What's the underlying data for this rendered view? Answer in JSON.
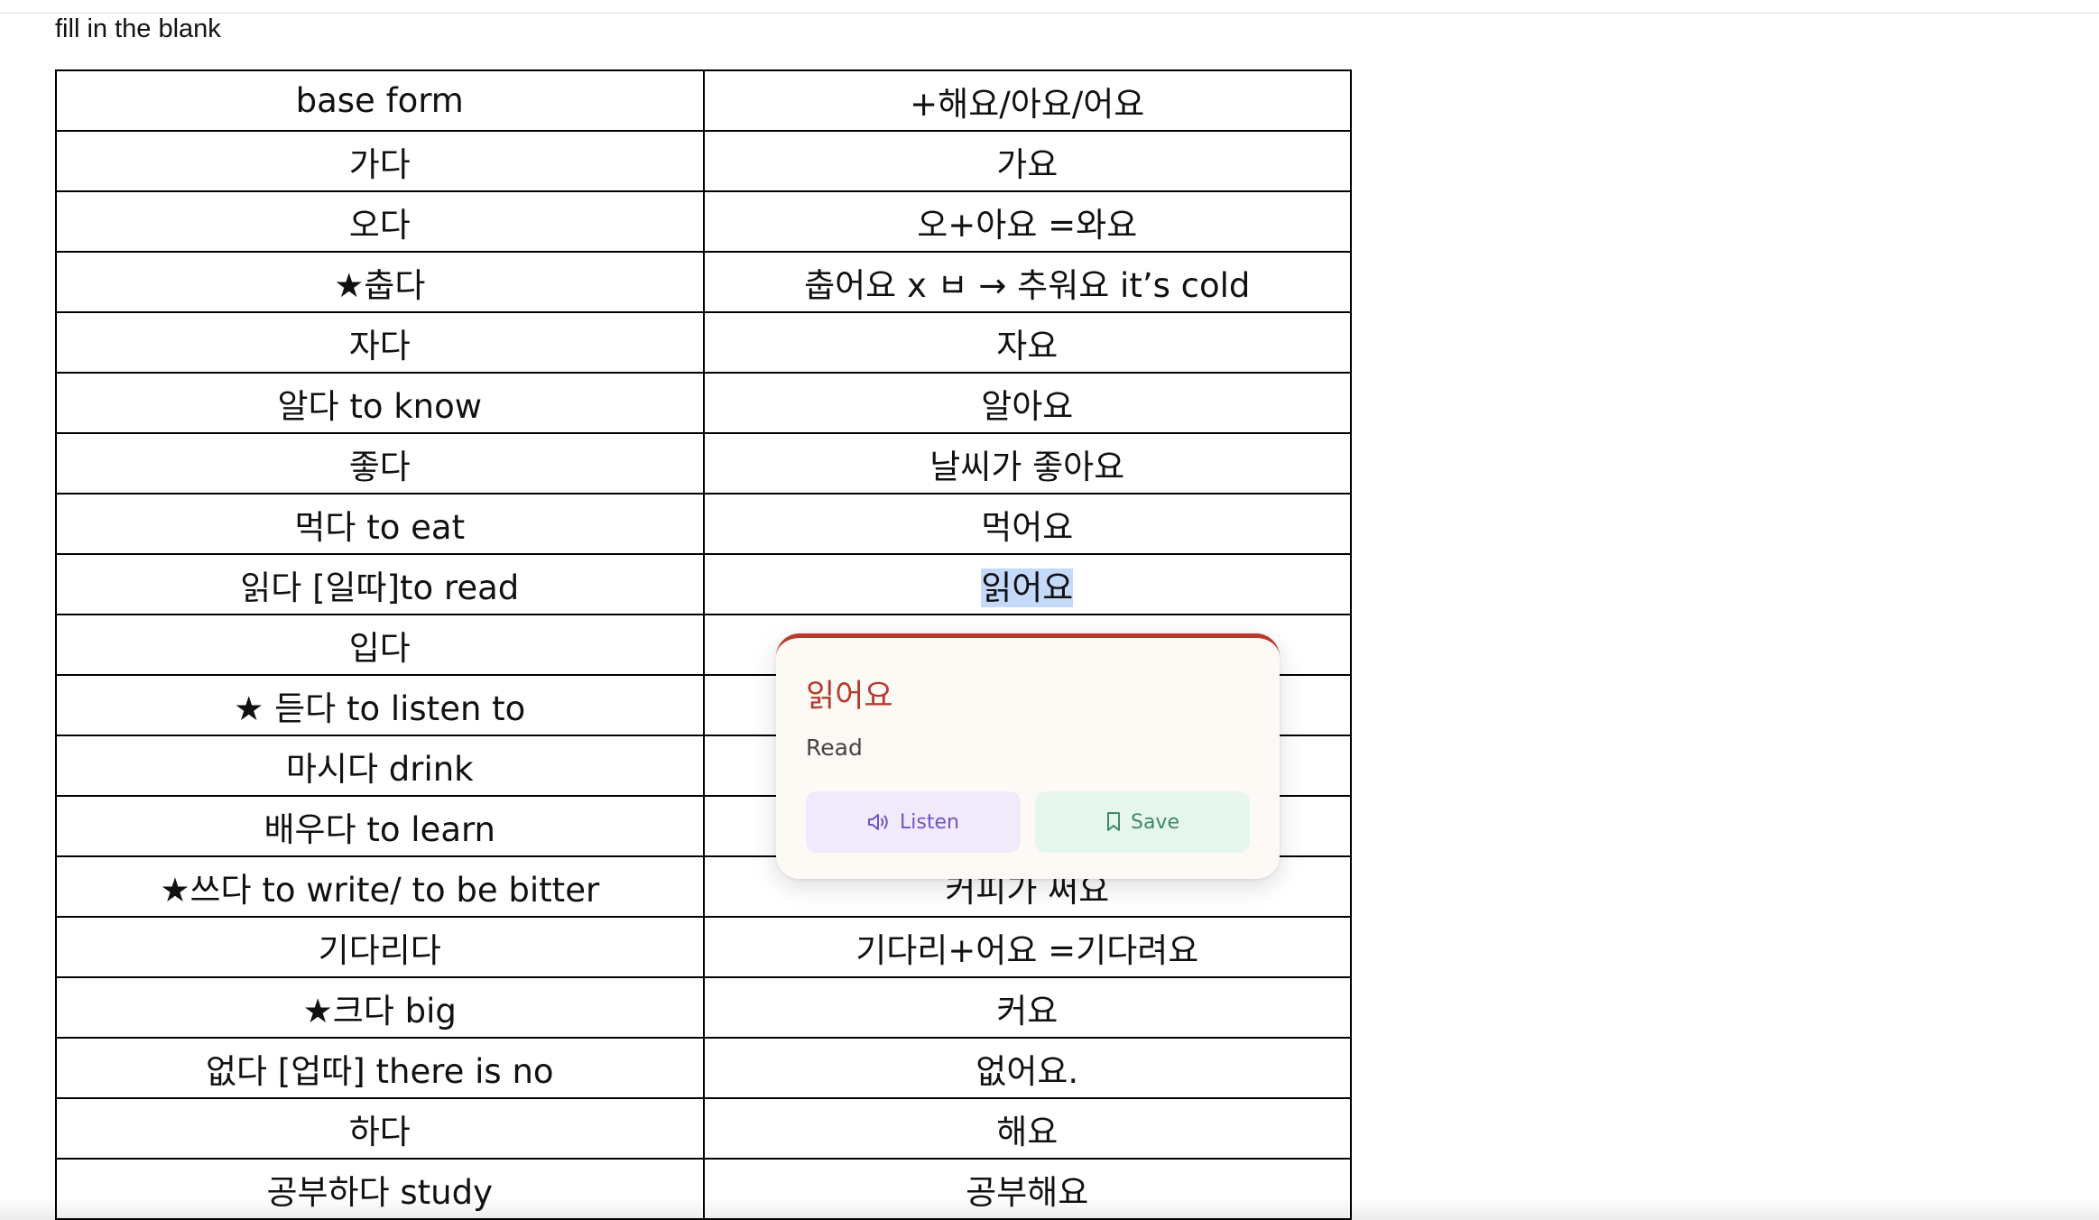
{
  "doc": {
    "instruction": "fill in the blank"
  },
  "table": {
    "rows": [
      [
        "base form",
        "+해요/아요/어요"
      ],
      [
        "가다",
        "가요"
      ],
      [
        "오다",
        "오+아요  =와요"
      ],
      [
        "★춥다",
        "춥어요 x ㅂ → 추워요 it’s cold"
      ],
      [
        "자다",
        "자요"
      ],
      [
        "알다 to know",
        "알아요"
      ],
      [
        "좋다",
        "날씨가 좋아요"
      ],
      [
        "먹다 to eat",
        "먹어요"
      ],
      [
        "읽다 [일따]to read",
        "읽어요"
      ],
      [
        "입다",
        ""
      ],
      [
        "★ 듣다 to listen to",
        ""
      ],
      [
        "마시다 drink",
        ""
      ],
      [
        "배우다 to learn",
        ""
      ],
      [
        "★쓰다 to write/ to be bitter",
        "커피가 써요"
      ],
      [
        "기다리다",
        "기다리+어요 =기다려요"
      ],
      [
        "★크다 big",
        "커요"
      ],
      [
        "없다 [업따] there is no",
        "없어요."
      ],
      [
        "하다",
        "해요"
      ],
      [
        "공부하다 study",
        "공부해요"
      ]
    ]
  },
  "popup": {
    "word": "읽어요",
    "meaning": "Read",
    "listen_label": "Listen",
    "save_label": "Save",
    "listen_icon": "speaker-icon",
    "save_icon": "bookmark-icon",
    "accent_color": "#b63a2e"
  }
}
